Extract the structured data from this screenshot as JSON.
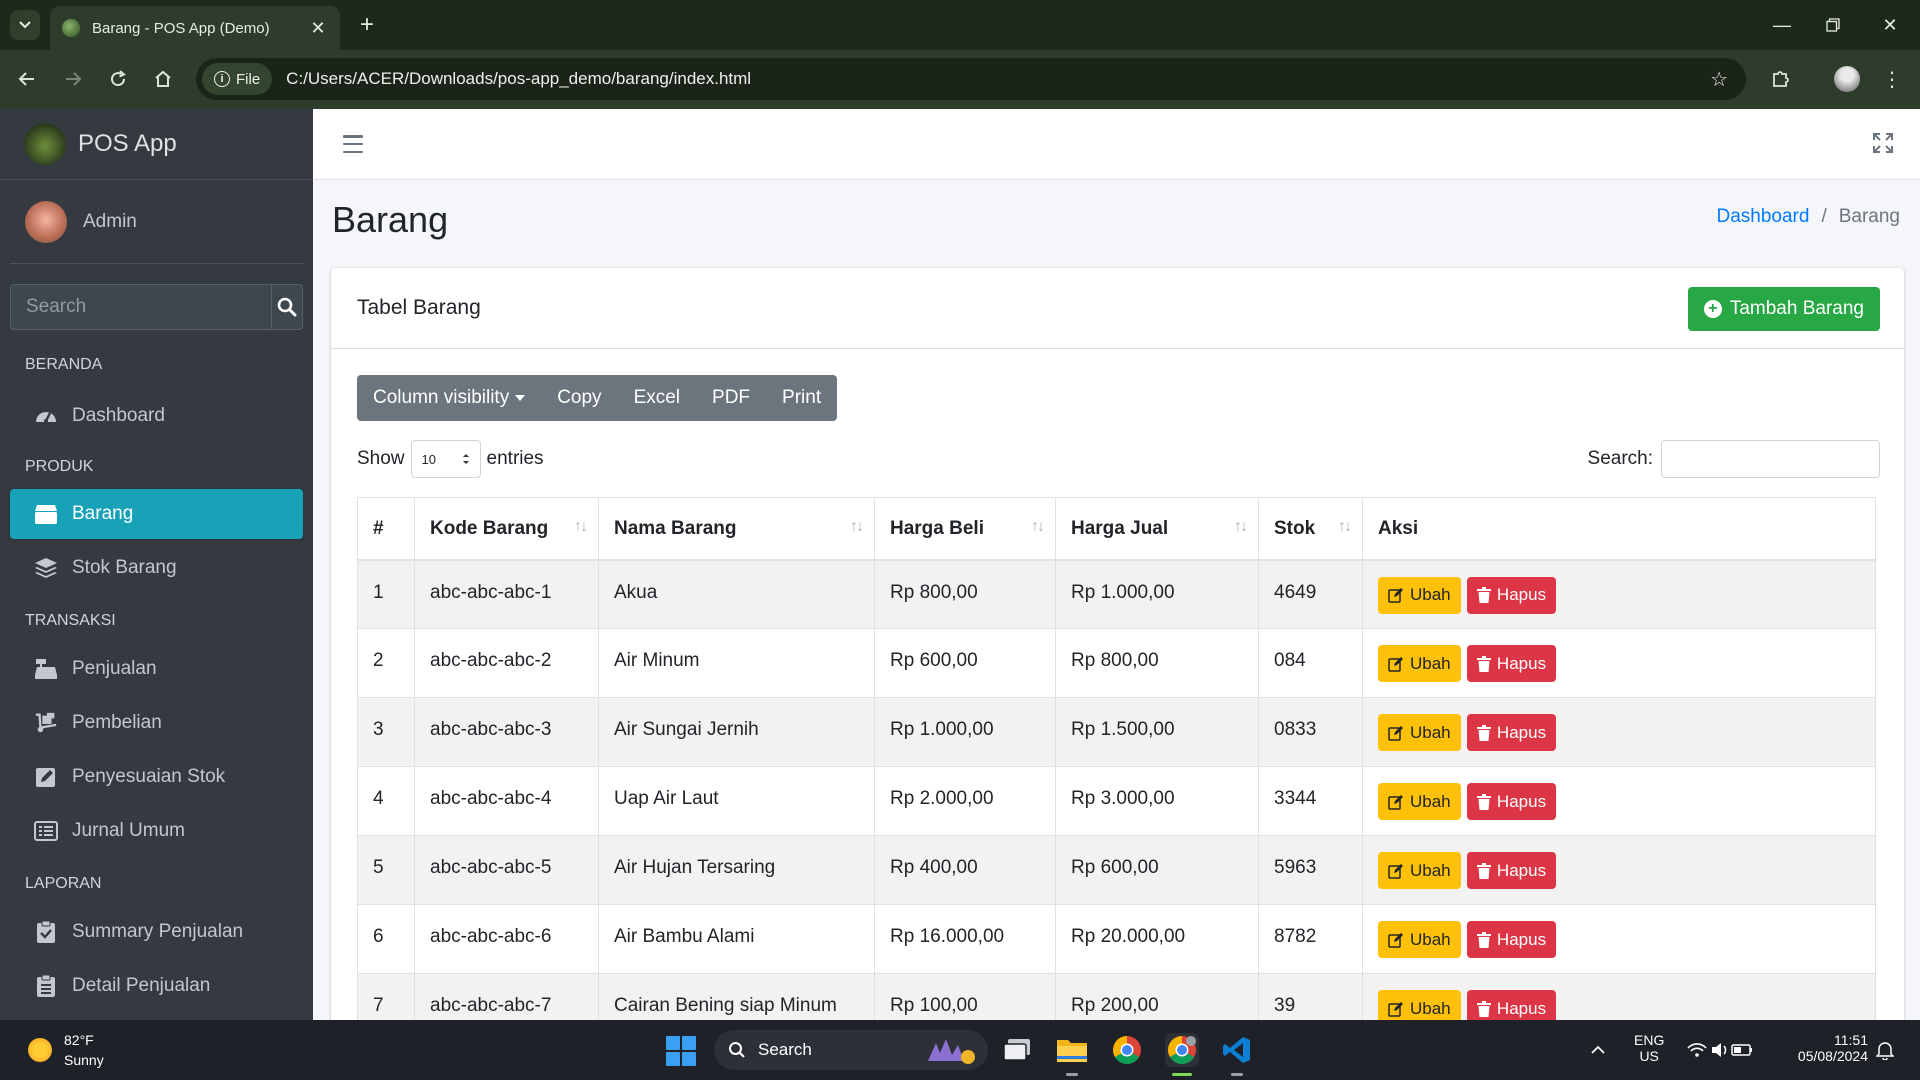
{
  "browser": {
    "tab_title": "Barang - POS App (Demo)",
    "file_chip": "File",
    "url": "C:/Users/ACER/Downloads/pos-app_demo/barang/index.html"
  },
  "sidebar": {
    "brand": "POS App",
    "user": "Admin",
    "search_placeholder": "Search",
    "sections": {
      "beranda": "BERANDA",
      "produk": "PRODUK",
      "transaksi": "TRANSAKSI",
      "laporan": "LAPORAN"
    },
    "items": {
      "dashboard": "Dashboard",
      "barang": "Barang",
      "stok_barang": "Stok Barang",
      "penjualan": "Penjualan",
      "pembelian": "Pembelian",
      "penyesuaian_stok": "Penyesuaian Stok",
      "jurnal_umum": "Jurnal Umum",
      "summary_penjualan": "Summary Penjualan",
      "detail_penjualan": "Detail Penjualan"
    }
  },
  "page": {
    "title": "Barang",
    "breadcrumb": {
      "home": "Dashboard",
      "sep": "/",
      "current": "Barang"
    }
  },
  "card": {
    "title": "Tabel Barang",
    "add_button": "Tambah Barang",
    "dt_buttons": [
      "Column visibility",
      "Copy",
      "Excel",
      "PDF",
      "Print"
    ],
    "length": {
      "show": "Show",
      "value": "10",
      "entries": "entries"
    },
    "search_label": "Search:"
  },
  "table": {
    "headers": [
      "#",
      "Kode Barang",
      "Nama Barang",
      "Harga Beli",
      "Harga Jual",
      "Stok",
      "Aksi"
    ],
    "rows": [
      [
        "1",
        "abc-abc-abc-1",
        "Akua",
        "Rp 800,00",
        "Rp 1.000,00",
        "4649"
      ],
      [
        "2",
        "abc-abc-abc-2",
        "Air Minum",
        "Rp 600,00",
        "Rp 800,00",
        "084"
      ],
      [
        "3",
        "abc-abc-abc-3",
        "Air Sungai Jernih",
        "Rp 1.000,00",
        "Rp 1.500,00",
        "0833"
      ],
      [
        "4",
        "abc-abc-abc-4",
        "Uap Air Laut",
        "Rp 2.000,00",
        "Rp 3.000,00",
        "3344"
      ],
      [
        "5",
        "abc-abc-abc-5",
        "Air Hujan Tersaring",
        "Rp 400,00",
        "Rp 600,00",
        "5963"
      ],
      [
        "6",
        "abc-abc-abc-6",
        "Air Bambu Alami",
        "Rp 16.000,00",
        "Rp 20.000,00",
        "8782"
      ],
      [
        "7",
        "abc-abc-abc-7",
        "Cairan Bening siap Minum",
        "Rp 100,00",
        "Rp 200,00",
        "39"
      ]
    ],
    "action_edit": "Ubah",
    "action_delete": "Hapus"
  },
  "taskbar": {
    "temp": "82°F",
    "weather": "Sunny",
    "search": "Search",
    "lang_top": "ENG",
    "lang_bottom": "US",
    "time": "11:51",
    "date": "05/08/2024"
  },
  "colors": {
    "sidebar_bg": "#343a40",
    "active_item": "#17a2b8",
    "add_button": "#28a745",
    "edit_button": "#ffc107",
    "delete_button": "#dc3545",
    "dt_buttons": "#6c757d"
  }
}
